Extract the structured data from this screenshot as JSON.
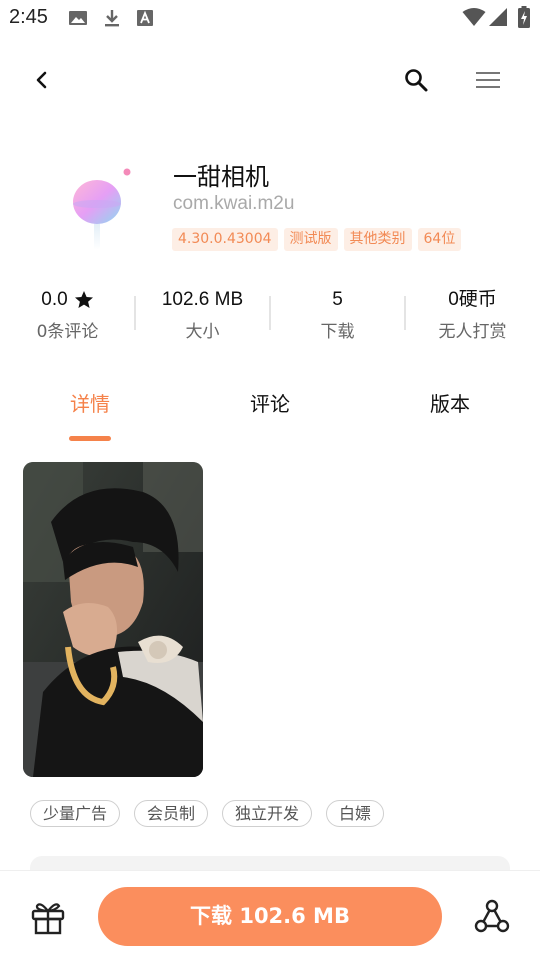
{
  "status_bar": {
    "time": "2:45"
  },
  "app": {
    "name": "一甜相机",
    "package": "com.kwai.m2u",
    "badges": [
      "4.30.0.43004",
      "测试版",
      "其他类别",
      "64位"
    ]
  },
  "stats": [
    {
      "value": "0.0",
      "label": "0条评论",
      "icon": "star-icon"
    },
    {
      "value": "102.6 MB",
      "label": "大小"
    },
    {
      "value": "5",
      "label": "下载"
    },
    {
      "value": "0硬币",
      "label": "无人打赏"
    }
  ],
  "tabs": [
    {
      "label": "详情",
      "active": true
    },
    {
      "label": "评论",
      "active": false
    },
    {
      "label": "版本",
      "active": false
    }
  ],
  "tags": [
    "少量广告",
    "会员制",
    "独立开发",
    "白嫖"
  ],
  "bottom_bar": {
    "download_label": "下载 102.6 MB"
  },
  "colors": {
    "accent": "#f5824a",
    "download_button": "#fb8e5d",
    "badge_bg": "#fdeee5",
    "badge_text": "#f28a55"
  }
}
